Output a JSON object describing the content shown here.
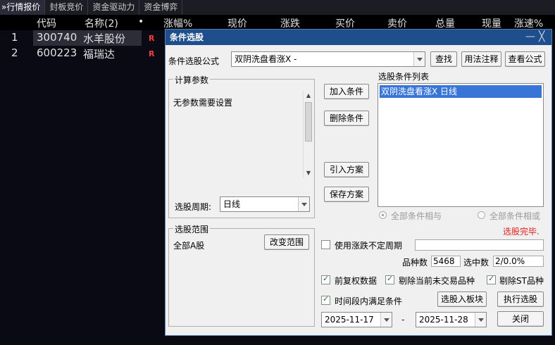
{
  "tabs": [
    {
      "label": "行情报价"
    },
    {
      "label": "封板竞价"
    },
    {
      "label": "资金驱动力"
    },
    {
      "label": "资金博弈"
    }
  ],
  "tab_prefix": "»",
  "table": {
    "headers": [
      "代码",
      "名称(2)",
      "•",
      "涨幅%",
      "现价",
      "涨跌",
      "买价",
      "卖价",
      "总量",
      "现量",
      "涨速%"
    ],
    "rows": [
      {
        "idx": "1",
        "code": "300740",
        "name": "水羊股份",
        "flag": "R"
      },
      {
        "idx": "2",
        "code": "600223",
        "name": "福瑞达",
        "flag": "R"
      }
    ]
  },
  "dialog": {
    "title": "条件选股",
    "minimize": "—",
    "close": "╳",
    "formula_label": "条件选股公式",
    "formula_value": "双阴洗盘看涨X  -",
    "find_btn": "查找",
    "usage_btn": "用法注释",
    "view_btn": "查看公式",
    "params_title": "计算参数",
    "params_text": "无参数需要设置",
    "period_label": "选股周期:",
    "period_value": "日线",
    "add_btn": "加入条件",
    "delete_btn": "删除条件",
    "import_btn": "引入方案",
    "save_btn": "保存方案",
    "conditions_title": "选股条件列表",
    "conditions": [
      "双阴洗盘看涨X  日线"
    ],
    "radio_and": "全部条件相与",
    "radio_or": "全部条件相或",
    "status": "选股完毕.",
    "scope_title": "选股范围",
    "scope_value": "全部A股",
    "change_scope_btn": "改变范围",
    "unfixed_period_label": "使用涨跌不定周期",
    "count_label": "品种数",
    "count_value": "5468",
    "selected_label": "选中数",
    "selected_value": "2/0.0%",
    "adj_label": "前复权数据",
    "remove_untraded_label": "剔除当前未交易品种",
    "remove_st_label": "剔除ST品种",
    "time_range_label": "时间段内满足条件",
    "to_block_btn": "选股入板块",
    "execute_btn": "执行选股",
    "start_date": "2025-11-17",
    "date_sep": "-",
    "end_date": "2025-11-28",
    "close_btn": "关闭"
  },
  "colors": {
    "title_bar": "#1f4e8c",
    "list_selection": "#3875d7",
    "status_text": "#e0201c",
    "flag_red": "#ff3b3b"
  }
}
